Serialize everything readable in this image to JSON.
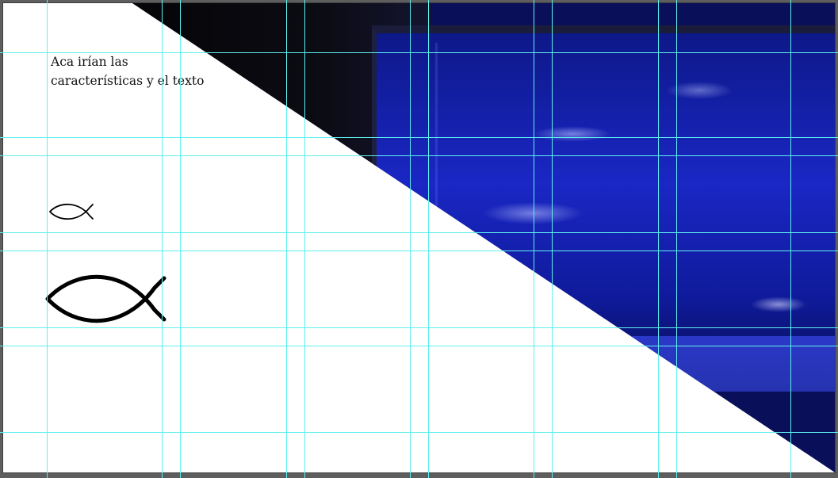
{
  "caption": {
    "line1": "Aca irían las",
    "line2": "características y el texto"
  },
  "icons": {
    "small": "fish-icon",
    "large": "fish-icon"
  },
  "colors": {
    "guides": "#5ef0ef",
    "artboard": "#ffffff",
    "photo_blue": "#1b2bd0"
  }
}
